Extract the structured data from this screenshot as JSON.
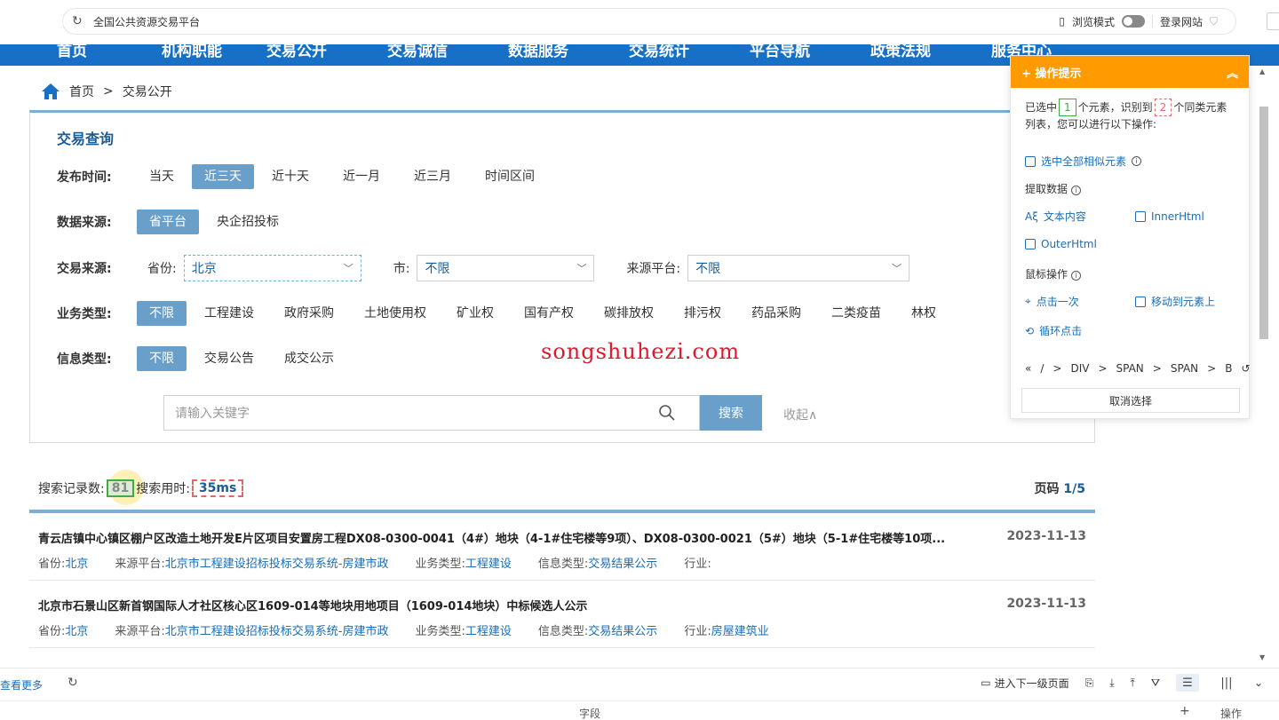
{
  "browser": {
    "url_text": "全国公共资源交易平台",
    "browse_mode_label": "浏览模式",
    "login_site_label": "登录网站"
  },
  "nav": {
    "items": [
      "首页",
      "机构职能",
      "交易公开",
      "交易诚信",
      "数据服务",
      "交易统计",
      "平台导航",
      "政策法规",
      "服务中心"
    ]
  },
  "breadcrumb": {
    "home": "首页",
    "separator": ">",
    "current": "交易公开"
  },
  "query": {
    "title": "交易查询",
    "publish_time": {
      "label": "发布时间:",
      "options": [
        "当天",
        "近三天",
        "近十天",
        "近一月",
        "近三月",
        "时间区间"
      ],
      "active": "近三天"
    },
    "data_source": {
      "label": "数据来源:",
      "options": [
        "省平台",
        "央企招投标"
      ],
      "active": "省平台"
    },
    "trade_source": {
      "label": "交易来源:",
      "province_label": "省份:",
      "province_value": "北京",
      "city_label": "市:",
      "city_value": "不限",
      "platform_label": "来源平台:",
      "platform_value": "不限"
    },
    "business_type": {
      "label": "业务类型:",
      "options": [
        "不限",
        "工程建设",
        "政府采购",
        "土地使用权",
        "矿业权",
        "国有产权",
        "碳排放权",
        "排污权",
        "药品采购",
        "二类疫苗",
        "林权"
      ],
      "active": "不限"
    },
    "info_type": {
      "label": "信息类型:",
      "options": [
        "不限",
        "交易公告",
        "成交公示"
      ],
      "active": "不限"
    },
    "search": {
      "placeholder": "请输入关键字",
      "button": "搜索",
      "collapse": "收起∧"
    }
  },
  "results": {
    "count_label": "搜索记录数:",
    "count_value": "81",
    "time_label": "搜索用时:",
    "time_value": "35ms",
    "page_label": "页码",
    "page_value": "1/5",
    "items": [
      {
        "title": "青云店镇中心镇区棚户区改造土地开发E片区项目安置房工程DX08-0300-0041（4#）地块（4-1#住宅楼等9项）、DX08-0300-0021（5#）地块（5-1#住宅楼等10项...",
        "date": "2023-11-13",
        "province_label": "省份:",
        "province": "北京",
        "platform_label": "来源平台:",
        "platform": "北京市工程建设招标投标交易系统-房建市政",
        "business_label": "业务类型:",
        "business": "工程建设",
        "info_label": "信息类型:",
        "info": "交易结果公示",
        "industry_label": "行业:",
        "industry": ""
      },
      {
        "title": "北京市石景山区新首钢国际人才社区核心区1609-014等地块用地项目（1609-014地块）中标候选人公示",
        "date": "2023-11-13",
        "province_label": "省份:",
        "province": "北京",
        "platform_label": "来源平台:",
        "platform": "北京市工程建设招标投标交易系统-房建市政",
        "business_label": "业务类型:",
        "business": "工程建设",
        "info_label": "信息类型:",
        "info": "交易结果公示",
        "industry_label": "行业:",
        "industry": "房屋建筑业"
      }
    ]
  },
  "watermark": "songshuhezi.com",
  "tips": {
    "title": "+ 操作提示",
    "intro_selected": "已选中",
    "selected_count": "1",
    "intro_recognized": "个元素，识别到",
    "similar_count": "2",
    "intro_tail": "个同类元素列表，您可以进行以下操作:",
    "select_all": "选中全部相似元素",
    "extract_label": "提取数据",
    "text_content": "文本内容",
    "inner_html": "InnerHtml",
    "outer_html": "OuterHtml",
    "mouse_label": "鼠标操作",
    "click_once": "点击一次",
    "move_to": "移动到元素上",
    "loop_click": "循环点击",
    "path": [
      "«",
      "/",
      ">",
      "DIV",
      ">",
      "SPAN",
      ">",
      "SPAN",
      ">",
      "B"
    ],
    "cancel": "取消选择"
  },
  "bottom": {
    "view_more": "查看更多",
    "next_level": "进入下一级页面",
    "field_label": "字段",
    "plus": "+",
    "operation_label": "操作"
  },
  "colors": {
    "nav_blue": "#1770c6",
    "accent_blue": "#6a9fc9",
    "title_blue": "#1a5c96",
    "tips_orange": "#ff9a00",
    "watermark_red": "#e0182d"
  }
}
